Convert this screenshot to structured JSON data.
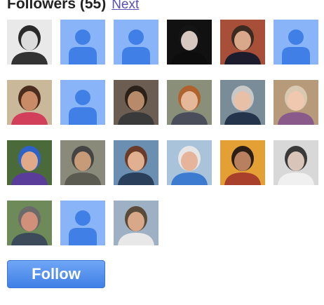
{
  "followers": {
    "title": "Followers (55)",
    "next_label": "Next",
    "follow_label": "Follow",
    "avatars": [
      {
        "kind": "photo",
        "bg": "#e9e9e9",
        "hair": "#2a2a2a",
        "skin": "#dcdcdc",
        "shirt": "#333333"
      },
      {
        "kind": "placeholder"
      },
      {
        "kind": "placeholder"
      },
      {
        "kind": "photo",
        "bg": "#111111",
        "hair": "#141414",
        "skin": "#d6c8c0",
        "shirt": "#0d0d0d"
      },
      {
        "kind": "photo",
        "bg": "#a84f3a",
        "hair": "#3b2a20",
        "skin": "#d9a88a",
        "shirt": "#1c1c2c"
      },
      {
        "kind": "placeholder"
      },
      {
        "kind": "photo",
        "bg": "#c9b89a",
        "hair": "#4a2d1c",
        "skin": "#c98a66",
        "shirt": "#d23f5a"
      },
      {
        "kind": "placeholder"
      },
      {
        "kind": "photo",
        "bg": "#6c5d52",
        "hair": "#2b2119",
        "skin": "#b78a6a",
        "shirt": "#3a3a3a"
      },
      {
        "kind": "photo",
        "bg": "#8a8f7a",
        "hair": "#b0622d",
        "skin": "#e5b89a",
        "shirt": "#4a4d5a"
      },
      {
        "kind": "photo",
        "bg": "#7a8c98",
        "hair": "#c8c8c8",
        "skin": "#e8c0a8",
        "shirt": "#24344a"
      },
      {
        "kind": "photo",
        "bg": "#b79a7a",
        "hair": "#d8c9b0",
        "skin": "#f0c8b0",
        "shirt": "#8a5a8a"
      },
      {
        "kind": "photo",
        "bg": "#4a6a3a",
        "hair": "#2f62c8",
        "skin": "#e0aa88",
        "shirt": "#5a3d9a"
      },
      {
        "kind": "photo",
        "bg": "#8a8a7a",
        "hair": "#444444",
        "skin": "#c79a78",
        "shirt": "#5b5b52"
      },
      {
        "kind": "photo",
        "bg": "#6a8fb0",
        "hair": "#6b3b2a",
        "skin": "#e0b090",
        "shirt": "#2a3f5a"
      },
      {
        "kind": "photo",
        "bg": "#a9c3da",
        "hair": "#e6e6e6",
        "skin": "#e5b49a",
        "shirt": "#3d7bd0"
      },
      {
        "kind": "photo",
        "bg": "#e4a034",
        "hair": "#2b1e14",
        "skin": "#b8805e",
        "shirt": "#a8402c"
      },
      {
        "kind": "photo",
        "bg": "#d8d8d8",
        "hair": "#3a3a3a",
        "skin": "#d8c4b8",
        "shirt": "#f0f0f0"
      },
      {
        "kind": "photo",
        "bg": "#6d8a58",
        "hair": "#6a6a6a",
        "skin": "#d0907a",
        "shirt": "#3c4a5a"
      },
      {
        "kind": "placeholder"
      },
      {
        "kind": "photo",
        "bg": "#9db0c4",
        "hair": "#5a4a3a",
        "skin": "#d8a888",
        "shirt": "#e8e8e8"
      }
    ],
    "colors": {
      "placeholder_bg": "#8ab4f8",
      "placeholder_fg": "#3f7fe6"
    }
  }
}
